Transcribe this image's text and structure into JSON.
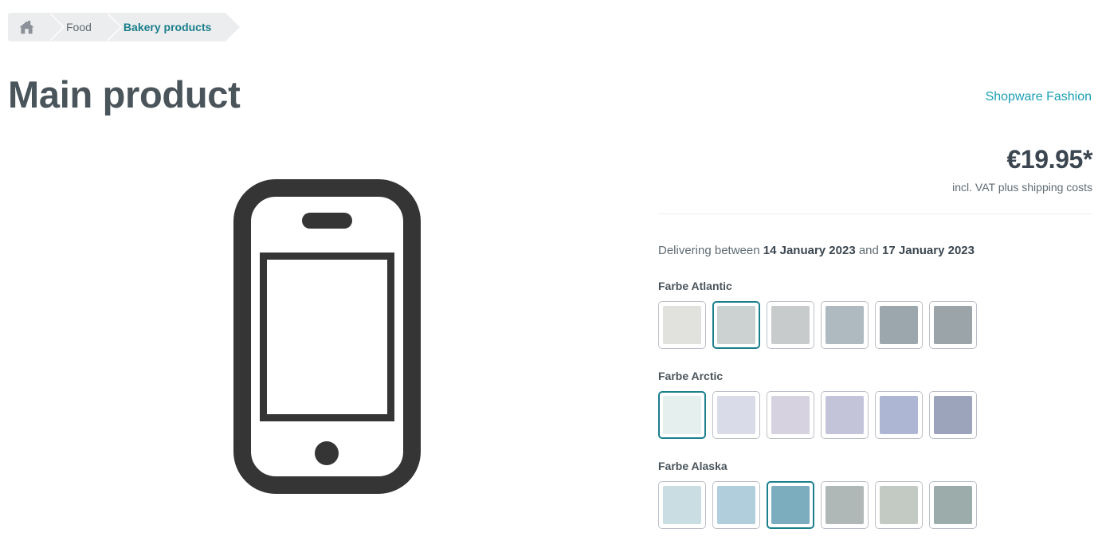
{
  "breadcrumb": {
    "home_icon": "home-icon",
    "items": [
      {
        "label": "Food",
        "active": false
      },
      {
        "label": "Bakery products",
        "active": true
      }
    ]
  },
  "page_title": "Main product",
  "manufacturer": {
    "label": "Shopware Fashion"
  },
  "gallery": {
    "placeholder_icon": "smartphone-placeholder-icon",
    "icon_color": "#353535"
  },
  "buy_widget": {
    "price": "€19.95*",
    "tax_info": "incl. VAT plus shipping costs",
    "delivery": {
      "prefix": "Delivering between ",
      "date_from": "14 January 2023",
      "middle": " and ",
      "date_to": "17 January 2023"
    },
    "variants": [
      {
        "label": "Farbe Atlantic",
        "swatches": [
          {
            "name": "atlantic-1",
            "color": "#e1e2de",
            "selected": false
          },
          {
            "name": "atlantic-2",
            "color": "#ccd2d1",
            "selected": true
          },
          {
            "name": "atlantic-3",
            "color": "#c8cbcb",
            "selected": false
          },
          {
            "name": "atlantic-4",
            "color": "#aeb9c0",
            "selected": false
          },
          {
            "name": "atlantic-5",
            "color": "#9ba6ad",
            "selected": false
          },
          {
            "name": "atlantic-6",
            "color": "#9aa4a9",
            "selected": false
          }
        ]
      },
      {
        "label": "Farbe Arctic",
        "swatches": [
          {
            "name": "arctic-1",
            "color": "#e5efed",
            "selected": true
          },
          {
            "name": "arctic-2",
            "color": "#d9dce8",
            "selected": false
          },
          {
            "name": "arctic-3",
            "color": "#d6d2e0",
            "selected": false
          },
          {
            "name": "arctic-4",
            "color": "#c3c4da",
            "selected": false
          },
          {
            "name": "arctic-5",
            "color": "#adb7d4",
            "selected": false
          },
          {
            "name": "arctic-6",
            "color": "#9ba4bb",
            "selected": false
          }
        ]
      },
      {
        "label": "Farbe Alaska",
        "swatches": [
          {
            "name": "alaska-1",
            "color": "#cadde2",
            "selected": false
          },
          {
            "name": "alaska-2",
            "color": "#b1cedd",
            "selected": false
          },
          {
            "name": "alaska-3",
            "color": "#7cadbf",
            "selected": true
          },
          {
            "name": "alaska-4",
            "color": "#afb8b6",
            "selected": false
          },
          {
            "name": "alaska-5",
            "color": "#c3cac3",
            "selected": false
          },
          {
            "name": "alaska-6",
            "color": "#9cacab",
            "selected": false
          }
        ]
      }
    ]
  },
  "colors": {
    "accent_teal": "#1b7f8c",
    "link_teal": "#1b9eb3",
    "text_dark": "#4a545b",
    "text_muted": "#5f6b73",
    "breadcrumb_bg": "#ecedee"
  }
}
